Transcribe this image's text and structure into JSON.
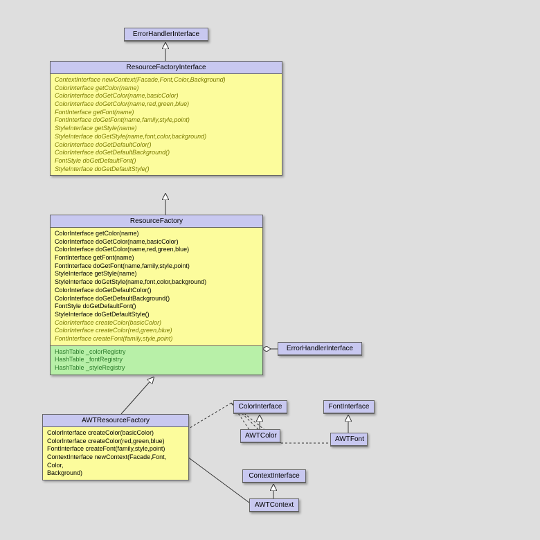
{
  "classes": {
    "errorHandler": {
      "name": "ErrorHandlerInterface"
    },
    "errorHandler2": {
      "name": "ErrorHandlerInterface"
    },
    "resourceFactoryInterface": {
      "name": "ResourceFactoryInterface",
      "methods": [
        "ContextInterface newContext(Facade,Font,Color,Background)",
        "ColorInterface getColor(name)",
        "ColorInterface doGetColor(name,basicColor)",
        "ColorInterface doGetColor(name,red,green,blue)",
        "FontInterface getFont(name)",
        "FontInterface doGetFont(name,family,style,point)",
        "StyleInterface getStyle(name)",
        "StyleInterface doGetStyle(name,font,color,background)",
        "ColorInterface doGetDefaultColor()",
        "ColorInterface doGetDefaultBackground()",
        "FontStyle doGetDefaultFont()",
        "StyleInterface doGetDefaultStyle()"
      ]
    },
    "resourceFactory": {
      "name": "ResourceFactory",
      "methods": [
        "ColorInterface getColor(name)",
        "ColorInterface doGetColor(name,basicColor)",
        "ColorInterface doGetColor(name,red,green,blue)",
        "FontInterface getFont(name)",
        "FontInterface doGetFont(name,family,style,point)",
        "StyleInterface getStyle(name)",
        "StyleInterface doGetStyle(name,font,color,background)",
        "ColorInterface doGetDefaultColor()",
        "ColorInterface doGetDefaultBackground()",
        "FontStyle doGetDefaultFont()",
        "StyleInterface doGetDefaultStyle()"
      ],
      "abstractMethods": [
        "ColorInterface createColor(basicColor)",
        "ColorInterface createColor(red,green,blue)",
        "FontInterface createFont(family,style,point)"
      ],
      "attributes": [
        "HashTable _colorRegistry",
        "HashTable _fontRegistry",
        "HashTable _styleRegistry"
      ]
    },
    "awtResourceFactory": {
      "name": "AWTResourceFactory",
      "methods": [
        "ColorInterface createColor(basicColor)",
        "ColorInterface createColor(red,green,blue)",
        "FontInterface createFont(family,style,point)",
        "ContextInterface newContext(Facade,Font,",
        "                                                Color,",
        "                                                Background)"
      ]
    },
    "colorInterface": {
      "name": "ColorInterface"
    },
    "awtColor": {
      "name": "AWTColor"
    },
    "fontInterface": {
      "name": "FontInterface"
    },
    "awtFont": {
      "name": "AWTFont"
    },
    "contextInterface": {
      "name": "ContextInterface"
    },
    "awtContext": {
      "name": "AWTContext"
    }
  }
}
